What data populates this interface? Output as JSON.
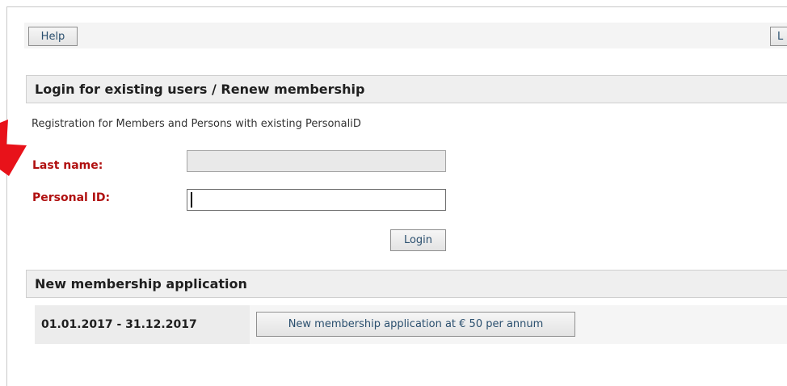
{
  "toolbar": {
    "help_label": "Help",
    "right_button_label": "L"
  },
  "login_section": {
    "title": "Login for existing users / Renew membership",
    "subtitle": "Registration for Members and Persons with existing PersonaliD",
    "last_name_label": "Last name:",
    "last_name_value": "",
    "personal_id_label": "Personal ID:",
    "personal_id_value": "",
    "login_button_label": "Login"
  },
  "application_section": {
    "title": "New membership application",
    "period": "01.01.2017 - 31.12.2017",
    "apply_button_label": "New membership application at € 50 per annum"
  },
  "colors": {
    "required_label": "#b01010",
    "annotation_arrow": "#e8121a",
    "button_text": "#2a4f6e"
  },
  "icons": {
    "annotation": "red-arrow-icon"
  }
}
